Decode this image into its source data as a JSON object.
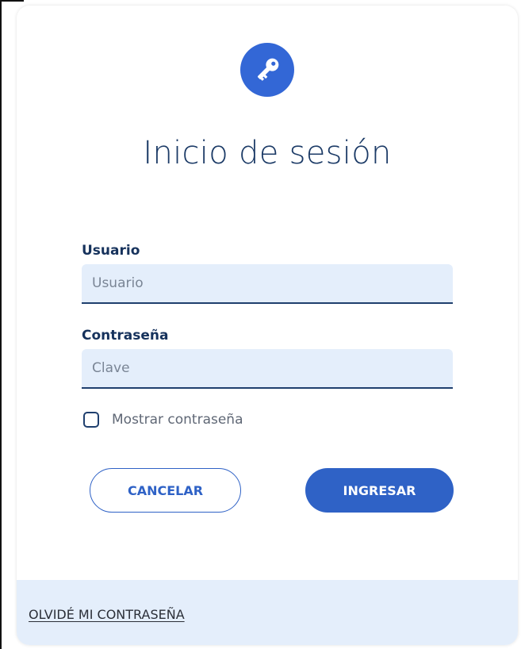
{
  "login": {
    "title": "Inicio de sesión",
    "username": {
      "label": "Usuario",
      "placeholder": "Usuario",
      "value": ""
    },
    "password": {
      "label": "Contraseña",
      "placeholder": "Clave",
      "value": ""
    },
    "show_password": {
      "label": "Mostrar contraseña",
      "checked": false
    },
    "cancel_label": "CANCELAR",
    "submit_label": "INGRESAR",
    "forgot_label": "OLVIDÉ MI CONTRASEÑA"
  },
  "icons": {
    "header_icon": "key-icon"
  },
  "colors": {
    "primary": "#2f62c6",
    "badge": "#3367d6",
    "heading": "#1b3a66",
    "input_bg": "#e4eefb",
    "footer_bg": "#e4eefb"
  }
}
